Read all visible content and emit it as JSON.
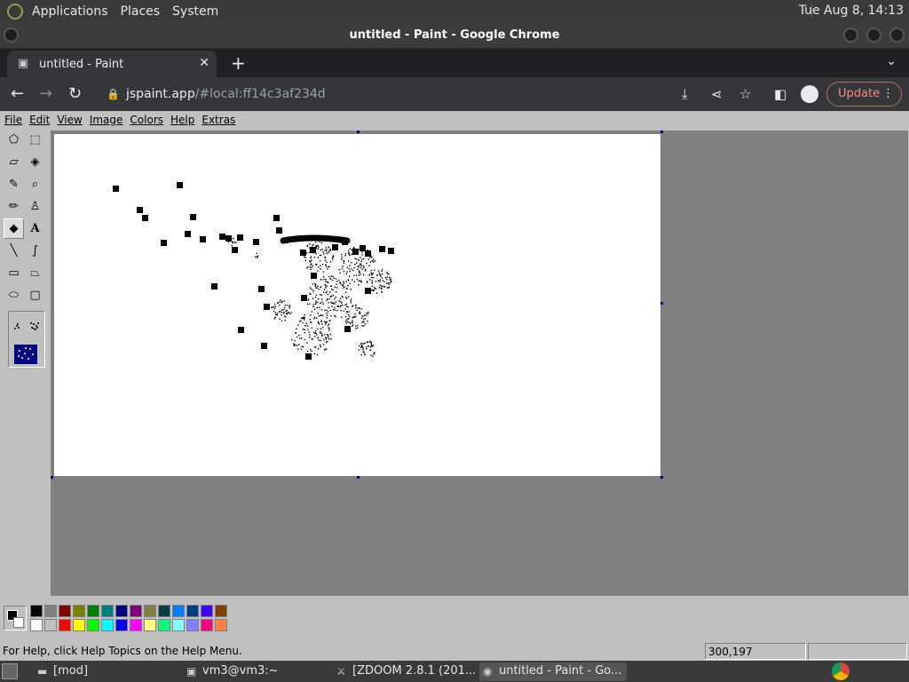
{
  "top_panel": {
    "menus": [
      "Applications",
      "Places",
      "System"
    ],
    "clock": "Tue Aug  8, 14:13"
  },
  "window": {
    "title": "untitled - Paint - Google Chrome"
  },
  "browser": {
    "tab_title": "untitled - Paint",
    "url_host": "jspaint.app",
    "url_path": "/#local:ff14c3af234d",
    "update_label": "Update"
  },
  "paint": {
    "menus": [
      "File",
      "Edit",
      "View",
      "Image",
      "Colors",
      "Help",
      "Extras"
    ],
    "tools": [
      "free-form-select",
      "select",
      "eraser",
      "fill",
      "pick-color",
      "magnifier",
      "pencil",
      "brush",
      "airbrush",
      "text",
      "line",
      "curve",
      "rectangle",
      "polygon",
      "ellipse",
      "rounded-rectangle"
    ],
    "active_tool": "airbrush",
    "palette_top": [
      "#000000",
      "#808080",
      "#800000",
      "#808000",
      "#008000",
      "#008080",
      "#000080",
      "#800080",
      "#808040",
      "#004040",
      "#0080ff",
      "#004080",
      "#4000ff",
      "#804000"
    ],
    "palette_bottom": [
      "#ffffff",
      "#c0c0c0",
      "#ff0000",
      "#ffff00",
      "#00ff00",
      "#00ffff",
      "#0000ff",
      "#ff00ff",
      "#ffff80",
      "#00ff80",
      "#80ffff",
      "#8080ff",
      "#ff0080",
      "#ff8040"
    ],
    "status_help": "For Help, click Help Topics on the Help Menu.",
    "status_coords": "300,197"
  },
  "taskbar": {
    "items": [
      "[mod]",
      "vm3@vm3:~",
      "[ZDOOM 2.8.1  (201...",
      "untitled - Paint - Go..."
    ]
  }
}
